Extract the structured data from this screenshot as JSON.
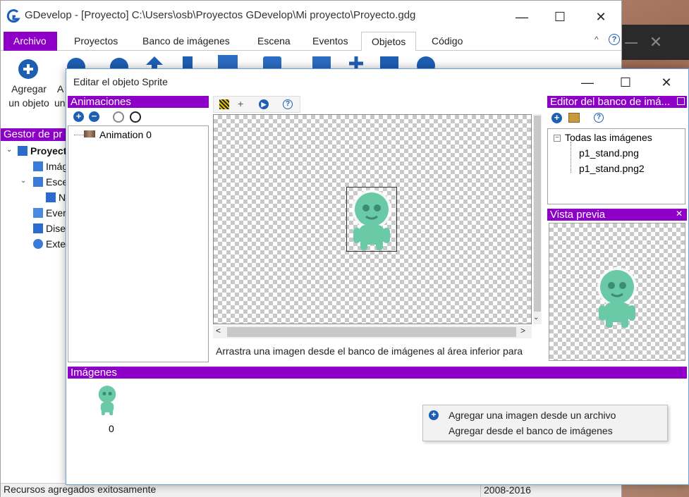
{
  "app": {
    "title": "GDevelop - [Proyecto] C:\\Users\\osb\\Proyectos GDevelop\\Mi proyecto\\Proyecto.gdg",
    "minimize": "—",
    "maximize": "☐",
    "close": "✕"
  },
  "ribbon_tabs": {
    "file": "Archivo",
    "projects": "Proyectos",
    "image_bank": "Banco de imágenes",
    "scene": "Escena",
    "events": "Eventos",
    "objects": "Objetos",
    "code": "Código",
    "collapse": "^",
    "help": "?"
  },
  "ribbon": {
    "add_object_line1": "Agregar",
    "add_object_line2": "un objeto",
    "cut_label_line1": "A",
    "cut_label_line2": "un"
  },
  "project_manager": {
    "header": "Gestor de pr",
    "project": "Proyecto",
    "images": "Imág",
    "scenes": "Esce",
    "new_scene": "N",
    "events": "Even",
    "layouts": "Dise",
    "extensions": "Exte"
  },
  "status": {
    "message": "Recursos agregados exitosamente",
    "years": "2008-2016"
  },
  "dialog": {
    "title": "Editar el objeto Sprite",
    "minimize": "—",
    "maximize": "☐",
    "close": "✕",
    "animations_header": "Animaciones",
    "animation_item": "Animation 0",
    "hint": "Arrastra una imagen desde el banco de imágenes al área inferior para",
    "image_bank_header": "Editor del banco de imá...",
    "image_bank_root": "Todas las imágenes",
    "image_bank_items": [
      "p1_stand.png",
      "p1_stand.png2"
    ],
    "preview_header": "Vista previa",
    "preview_close": "✕",
    "images_header": "Imágenes",
    "frame_index": "0",
    "context_menu": {
      "add_from_file": "Agregar una imagen desde un archivo",
      "add_from_bank": "Agregar desde el banco de imágenes"
    }
  },
  "colors": {
    "accent": "#8e00c8",
    "icon_blue": "#1e5fb4",
    "alien_green": "#6ac9a6"
  }
}
